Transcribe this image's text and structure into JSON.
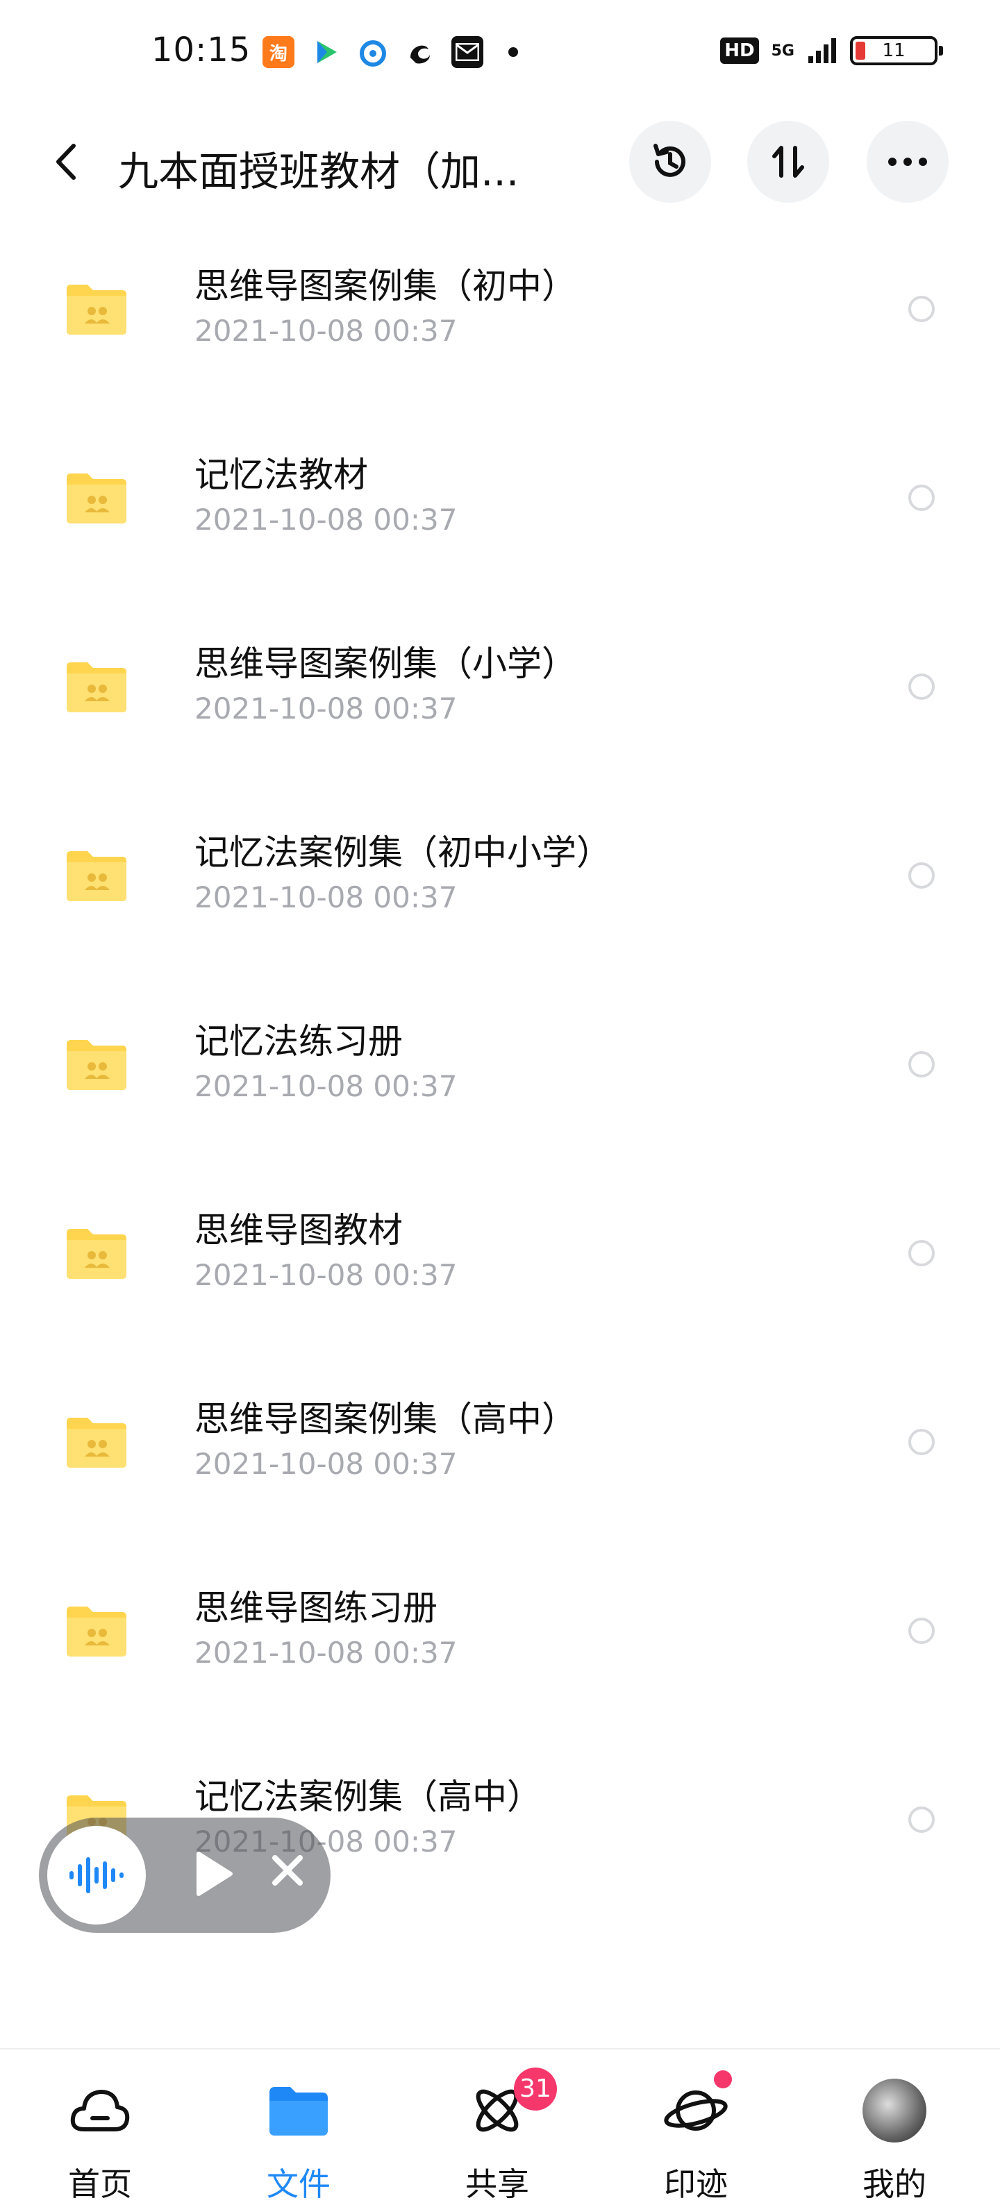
{
  "status_bar": {
    "time": "10:15",
    "app_icons": [
      "taobao-icon",
      "video-icon",
      "browser-icon",
      "uc-icon",
      "mail-icon"
    ],
    "hd": "HD",
    "network": "5G",
    "battery": "11"
  },
  "header": {
    "title": "九本面授班教材（加...",
    "buttons": [
      "history-icon",
      "sort-icon",
      "more-icon"
    ]
  },
  "files": [
    {
      "name": "思维导图案例集（初中）",
      "date": "2021-10-08  00:37"
    },
    {
      "name": "记忆法教材",
      "date": "2021-10-08  00:37"
    },
    {
      "name": "思维导图案例集（小学）",
      "date": "2021-10-08  00:37"
    },
    {
      "name": "记忆法案例集（初中小学）",
      "date": "2021-10-08  00:37"
    },
    {
      "name": "记忆法练习册",
      "date": "2021-10-08  00:37"
    },
    {
      "name": "思维导图教材",
      "date": "2021-10-08  00:37"
    },
    {
      "name": "思维导图案例集（高中）",
      "date": "2021-10-08  00:37"
    },
    {
      "name": "思维导图练习册",
      "date": "2021-10-08  00:37"
    },
    {
      "name": "记忆法案例集（高中）",
      "date": "2021-10-08  00:37"
    }
  ],
  "bottom_nav": {
    "tabs": [
      {
        "label": "首页",
        "icon": "cloud-icon"
      },
      {
        "label": "文件",
        "icon": "folder-icon"
      },
      {
        "label": "共享",
        "icon": "atom-icon",
        "badge": "31"
      },
      {
        "label": "印迹",
        "icon": "planet-icon"
      },
      {
        "label": "我的",
        "icon": "avatar"
      }
    ],
    "active_index": 1
  },
  "colors": {
    "accent": "#1f88f7",
    "folder": "#ffd54f",
    "badge": "#f5376b",
    "date_text": "#a8aab0"
  }
}
